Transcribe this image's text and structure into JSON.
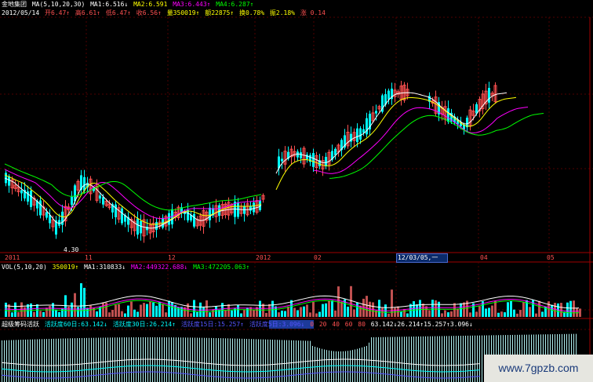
{
  "price_header": {
    "stock_name": "金地集团",
    "ma_label": "MA(5,10,20,30)",
    "ma1": "MA1:6.516↓",
    "ma2": "MA2:6.591",
    "ma3": "MA3:6.443↑",
    "ma4": "MA4:6.287↑"
  },
  "quote_line": {
    "date": "2012/05/14",
    "open": "开6.47↑",
    "high": "高6.61↑",
    "low": "低6.47↑",
    "close": "收6.56↑",
    "volume": "量350019↑",
    "amount": "额22875↑",
    "turnover": "换0.78%",
    "amplitude": "振2.18%",
    "change": "涨 0.14"
  },
  "price_annotations": {
    "low_marker": "4.30"
  },
  "x_axis": {
    "labels": [
      "2011",
      "11",
      "12",
      "2012",
      "02",
      "04",
      "05"
    ],
    "cursor_date": "12/03/05,一"
  },
  "vol_header": {
    "label": "VOL(5,10,20)",
    "value": "350019↑",
    "ma1": "MA1:310833↓",
    "ma2": "MA2:449322.688↓",
    "ma3": "MA3:472205.063↑"
  },
  "activity_header": {
    "title": "超级筹码活跃",
    "d60": "活跃度60日:63.142↓",
    "d30": "活跃度30日:26.214↑",
    "d15": "活跃度15日:15.257↑",
    "d5": "活跃度5日:3.096↓",
    "scale": [
      "0",
      "20",
      "40",
      "60",
      "80"
    ],
    "summary": "63.142↓26.214↑15.257↑3.096↓"
  },
  "watermark": "www.7gpzb.com",
  "colors": {
    "up": "#ff5050",
    "down": "#00ffff",
    "ma1": "#ffffff",
    "ma2": "#ffff00",
    "ma3": "#ff00ff",
    "ma4": "#00ff00",
    "accent_blue": "#5555ff"
  }
}
